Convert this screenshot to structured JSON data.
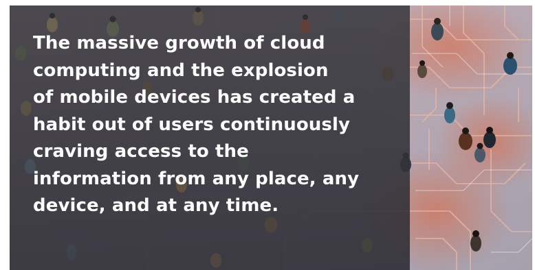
{
  "quote": {
    "text": "The massive growth of cloud\ncomputing and the explosion\nof mobile devices has created a\nhabit out of users continuously\ncraving access to the\ninformation from any place, any\ndevice, and at any time."
  },
  "colors": {
    "text": "#ffffff",
    "overlay": "#2a2a30",
    "circuit_lines": "#e8b8a6",
    "accent_glow": "#e0623a"
  },
  "icons": {
    "background": "aerial-crowd-circuit-photo"
  }
}
